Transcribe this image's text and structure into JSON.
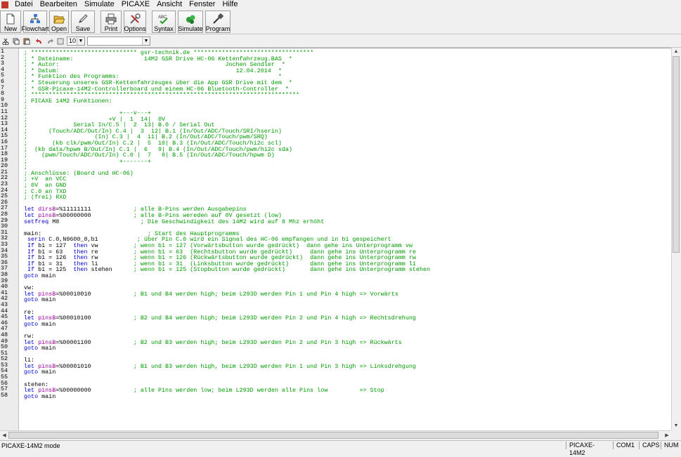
{
  "menu": [
    "Datei",
    "Bearbeiten",
    "Simulate",
    "PICAXE",
    "Ansicht",
    "Fenster",
    "Hilfe"
  ],
  "toolbar": [
    {
      "label": "New",
      "icon": "new-file-icon"
    },
    {
      "label": "Flowchart",
      "icon": "flowchart-icon"
    },
    {
      "label": "Open",
      "icon": "open-folder-icon"
    },
    {
      "label": "Save",
      "icon": "save-pen-icon"
    },
    {
      "label": "Print",
      "icon": "printer-icon"
    },
    {
      "label": "Options",
      "icon": "tools-icon"
    },
    {
      "label": "Syntax",
      "icon": "syntax-check-icon"
    },
    {
      "label": "Simulate",
      "icon": "simulate-icon"
    },
    {
      "label": "Program",
      "icon": "program-cable-icon"
    }
  ],
  "toolbar2": {
    "font_size": "10",
    "font_name": ""
  },
  "colors": {
    "comment": "#009900",
    "keyword": "#0000cc",
    "variable": "#990099",
    "text": "#000000"
  },
  "code_lines": [
    [
      [
        "c",
        "; ****************************** gsr-technik.de **********************************"
      ]
    ],
    [
      [
        "c",
        "; * Dateiname:                    14M2 GSR Drive HC-06 Kettenfahrzeug.BAS  *"
      ]
    ],
    [
      [
        "c",
        "; * Autor:                                               Jochen Sendler  *"
      ]
    ],
    [
      [
        "c",
        "; * Datum:                                                  12.04.2014  *"
      ]
    ],
    [
      [
        "c",
        "; * Funktion des Programms:                                             *"
      ]
    ],
    [
      [
        "c",
        "; * Steuerung unseres GSR-Kettenfahrzeuges über die App GSR Drive mit dem  *"
      ]
    ],
    [
      [
        "c",
        "; * GSR-Picaxe-14M2-Controllerboard und einem HC-06 Bluetooth-Controller  *"
      ]
    ],
    [
      [
        "c",
        "; ****************************************************************************"
      ]
    ],
    [
      [
        "c",
        "; PICAXE 14M2 Funktionen:"
      ]
    ],
    [
      [
        "c",
        ";"
      ]
    ],
    [
      [
        "c",
        ";                          +---v---+"
      ]
    ],
    [
      [
        "c",
        ";                       +V |  1  14|  0V"
      ]
    ],
    [
      [
        "c",
        ";             Serial In/C.5 |  2  13| B.0 / Serial Out"
      ]
    ],
    [
      [
        "c",
        ";      (Touch/ADC/Out/In) C.4 |  3  12| B.1 (In/Out/ADC/Touch/SRI/hserin)"
      ]
    ],
    [
      [
        "c",
        ";                   (In) C.3 |  4  11| B.2 (In/Out/ADC/Touch/pwm/SRQ)"
      ]
    ],
    [
      [
        "c",
        ";       (kb clk/pwm/Out/In) C.2 |  5  10| B.3 (In/Out/ADC/Touch/hi2c scl)"
      ]
    ],
    [
      [
        "c",
        ";  (kb data/hpwm B/Out/In) C.1 |  6   9| B.4 (In/Out/ADC/Touch/pwm/hi2c sda)"
      ]
    ],
    [
      [
        "c",
        ";    (pwm/Touch/ADC/Out/In) C.0 |  7   8| B.5 (In/Out/ADC/Touch/hpwm D)"
      ]
    ],
    [
      [
        "c",
        ";                          +-------+"
      ]
    ],
    [
      [
        "c",
        ";"
      ]
    ],
    [
      [
        "c",
        "; Anschlüsse: (Board und HC-06)"
      ]
    ],
    [
      [
        "c",
        "; +V  an VCC"
      ]
    ],
    [
      [
        "c",
        "; 0V  an GND"
      ]
    ],
    [
      [
        "c",
        "; C.0 an TXD"
      ]
    ],
    [
      [
        "c",
        "; (frei) RXD"
      ]
    ],
    [],
    [
      [
        "k",
        "let "
      ],
      [
        "v",
        "dirsB"
      ],
      [
        "t",
        "=%11111111            "
      ],
      [
        "c",
        "; alle B-Pins werden Ausgabepins"
      ]
    ],
    [
      [
        "k",
        "let "
      ],
      [
        "v",
        "pinsB"
      ],
      [
        "t",
        "=%00000000            "
      ],
      [
        "c",
        "; alle B-Pins wereden auf 0V gesetzt (low)"
      ]
    ],
    [
      [
        "k",
        "setfreq "
      ],
      [
        "t",
        "M8                       "
      ],
      [
        "c",
        "; Die Geschwindigkeit des 14M2 wird auf 8 Mhz erhöht"
      ]
    ],
    [],
    [
      [
        "t",
        "main:                              "
      ],
      [
        "c",
        "; Start des Hauptprogramms"
      ]
    ],
    [
      [
        "t",
        " "
      ],
      [
        "k",
        "serin "
      ],
      [
        "t",
        "C.0,N9600_8,b1           "
      ],
      [
        "c",
        "; über Pin C.0 wird ein Signal des HC-06 empfangen und in b1 gespeichert"
      ]
    ],
    [
      [
        "t",
        " "
      ],
      [
        "k",
        "If "
      ],
      [
        "t",
        "b1 = 127  "
      ],
      [
        "k",
        "then "
      ],
      [
        "t",
        "vw          "
      ],
      [
        "c",
        "; wenn b1 = 127 (Vorwärtsbutton wurde gedrückt)  dann gehe ins Unterprogramm vw"
      ]
    ],
    [
      [
        "t",
        " "
      ],
      [
        "k",
        "If "
      ],
      [
        "t",
        "b1 = 63   "
      ],
      [
        "k",
        "then "
      ],
      [
        "t",
        "re          "
      ],
      [
        "c",
        "; wenn b1 = 63  (Rechtsbutton wurde gedrückt)     dann gehe ins Unterprogramm re"
      ]
    ],
    [
      [
        "t",
        " "
      ],
      [
        "k",
        "If "
      ],
      [
        "t",
        "b1 = 126  "
      ],
      [
        "k",
        "then "
      ],
      [
        "t",
        "rw          "
      ],
      [
        "c",
        "; wenn b1 = 126 (Rückwärtsbutton wurde gedrückt)  dann gehe ins Unterprogramm rw"
      ]
    ],
    [
      [
        "t",
        " "
      ],
      [
        "k",
        "If "
      ],
      [
        "t",
        "b1 = 31   "
      ],
      [
        "k",
        "then "
      ],
      [
        "t",
        "li          "
      ],
      [
        "c",
        "; wenn b1 = 31  (Linksbutton wurde gedrückt)      dann gehe ins Unterprogramm li"
      ]
    ],
    [
      [
        "t",
        " "
      ],
      [
        "k",
        "If "
      ],
      [
        "t",
        "b1 = 125  "
      ],
      [
        "k",
        "then "
      ],
      [
        "t",
        "stehen      "
      ],
      [
        "c",
        "; wenn b1 = 125 (Stopbutton wurde gedrückt)       dann gehe ins Unterprogramm stehen"
      ]
    ],
    [
      [
        "k",
        "goto "
      ],
      [
        "t",
        "main"
      ]
    ],
    [],
    [
      [
        "t",
        "vw:"
      ]
    ],
    [
      [
        "k",
        "let "
      ],
      [
        "v",
        "pinsB"
      ],
      [
        "t",
        "=%00010010            "
      ],
      [
        "c",
        "; B1 und B4 werden high; beim L293D werden Pin 1 und Pin 4 high => Vorwärts"
      ]
    ],
    [
      [
        "k",
        "goto "
      ],
      [
        "t",
        "main"
      ]
    ],
    [],
    [
      [
        "t",
        "re:"
      ]
    ],
    [
      [
        "k",
        "let "
      ],
      [
        "v",
        "pinsB"
      ],
      [
        "t",
        "=%00010100            "
      ],
      [
        "c",
        "; B2 und B4 werden high; beim L293D werden Pin 2 und Pin 4 high => Rechtsdrehung"
      ]
    ],
    [
      [
        "k",
        "goto "
      ],
      [
        "t",
        "main"
      ]
    ],
    [],
    [
      [
        "t",
        "rw:"
      ]
    ],
    [
      [
        "k",
        "let "
      ],
      [
        "v",
        "pinsB"
      ],
      [
        "t",
        "=%00001100            "
      ],
      [
        "c",
        "; B2 und B3 werden high; beim L293D werden Pin 2 und Pin 3 high => Rückwärts"
      ]
    ],
    [
      [
        "k",
        "goto "
      ],
      [
        "t",
        "main"
      ]
    ],
    [],
    [
      [
        "t",
        "li:"
      ]
    ],
    [
      [
        "k",
        "let "
      ],
      [
        "v",
        "pinsB"
      ],
      [
        "t",
        "=%00001010            "
      ],
      [
        "c",
        "; B1 und B3 werden high, beim L293D werden Pin 1 und Pin 3 high => Linksdrehgung"
      ]
    ],
    [
      [
        "k",
        "goto "
      ],
      [
        "t",
        "main"
      ]
    ],
    [],
    [
      [
        "t",
        "stehen:"
      ]
    ],
    [
      [
        "k",
        "let "
      ],
      [
        "v",
        "pinsB"
      ],
      [
        "t",
        "=%00000000            "
      ],
      [
        "c",
        "; alle Pins werden low; beim L293D werden alle Pins low         => Stop"
      ]
    ],
    [
      [
        "k",
        "goto "
      ],
      [
        "t",
        "main"
      ]
    ]
  ],
  "status": {
    "mode": "PICAXE-14M2 mode",
    "chip": "PICAXE-14M2",
    "port": "COM1",
    "caps": "CAPS",
    "num": "NUM"
  }
}
